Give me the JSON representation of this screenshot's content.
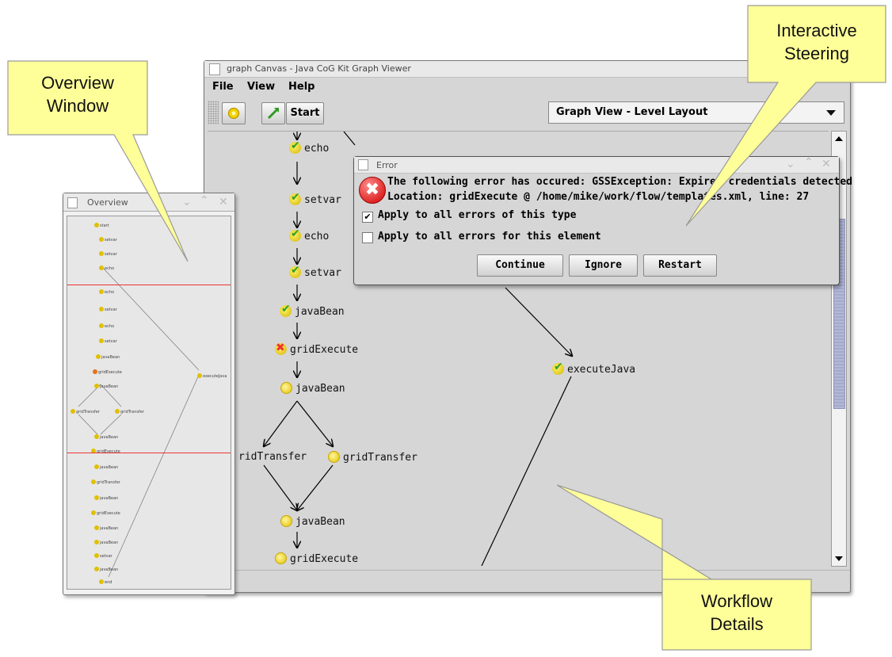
{
  "main_window": {
    "title": "graph Canvas - Java CoG Kit Graph Viewer",
    "menu": [
      "File",
      "View",
      "Help"
    ],
    "toolbar": {
      "start_label": "Start",
      "view_select": "Graph View - Level Layout"
    }
  },
  "graph_nodes": [
    {
      "label": "echo",
      "status": "done"
    },
    {
      "label": "setvar",
      "status": "done"
    },
    {
      "label": "echo",
      "status": "done"
    },
    {
      "label": "setvar",
      "status": "done"
    },
    {
      "label": "javaBean",
      "status": "done"
    },
    {
      "label": "gridExecute",
      "status": "error"
    },
    {
      "label": "javaBean",
      "status": "pending"
    },
    {
      "label": "ridTransfer",
      "status": "pending"
    },
    {
      "label": "gridTransfer",
      "status": "pending"
    },
    {
      "label": "javaBean",
      "status": "pending"
    },
    {
      "label": "gridExecute",
      "status": "pending"
    },
    {
      "label": "executeJava",
      "status": "done"
    }
  ],
  "error_dialog": {
    "title": "Error",
    "message_line1": "The following error has occured: GSSException: Expired credentials detected",
    "message_line2": "Location: gridExecute @ /home/mike/work/flow/templates.xml, line: 27",
    "check1_label": "Apply to all errors of this type",
    "check1_checked": true,
    "check2_label": "Apply to all errors for this element",
    "check2_checked": false,
    "buttons": {
      "continue": "Continue",
      "ignore": "Ignore",
      "restart": "Restart"
    }
  },
  "overview_window": {
    "title": "Overview",
    "mini_nodes": [
      "start",
      "setvar",
      "setvar",
      "echo",
      "echo",
      "setvar",
      "echo",
      "setvar",
      "javaBean",
      "gridExecute",
      "javaBean",
      "gridTransfer",
      "gridTransfer",
      "javaBean",
      "gridExecute",
      "javaBean",
      "gridTransfer",
      "javaBean",
      "gridExecute",
      "javaBean",
      "javaBean",
      "setvar",
      "javaBean",
      "end",
      "executeJava"
    ]
  },
  "callouts": {
    "overview": [
      "Overview",
      "Window"
    ],
    "steering": [
      "Interactive",
      "Steering"
    ],
    "workflow": [
      "Workflow",
      "Details"
    ]
  },
  "colors": {
    "callout_fill": "#ffff99",
    "error_red": "#d10000",
    "viewport_red": "#ee3333",
    "scroll_thumb": "#b3b8d6"
  },
  "icons": [
    "gear-icon",
    "arrow-icon",
    "check-icon",
    "error-icon",
    "pending-icon",
    "chevron-down-icon",
    "close-icon",
    "minimize-icon",
    "maximize-icon"
  ]
}
